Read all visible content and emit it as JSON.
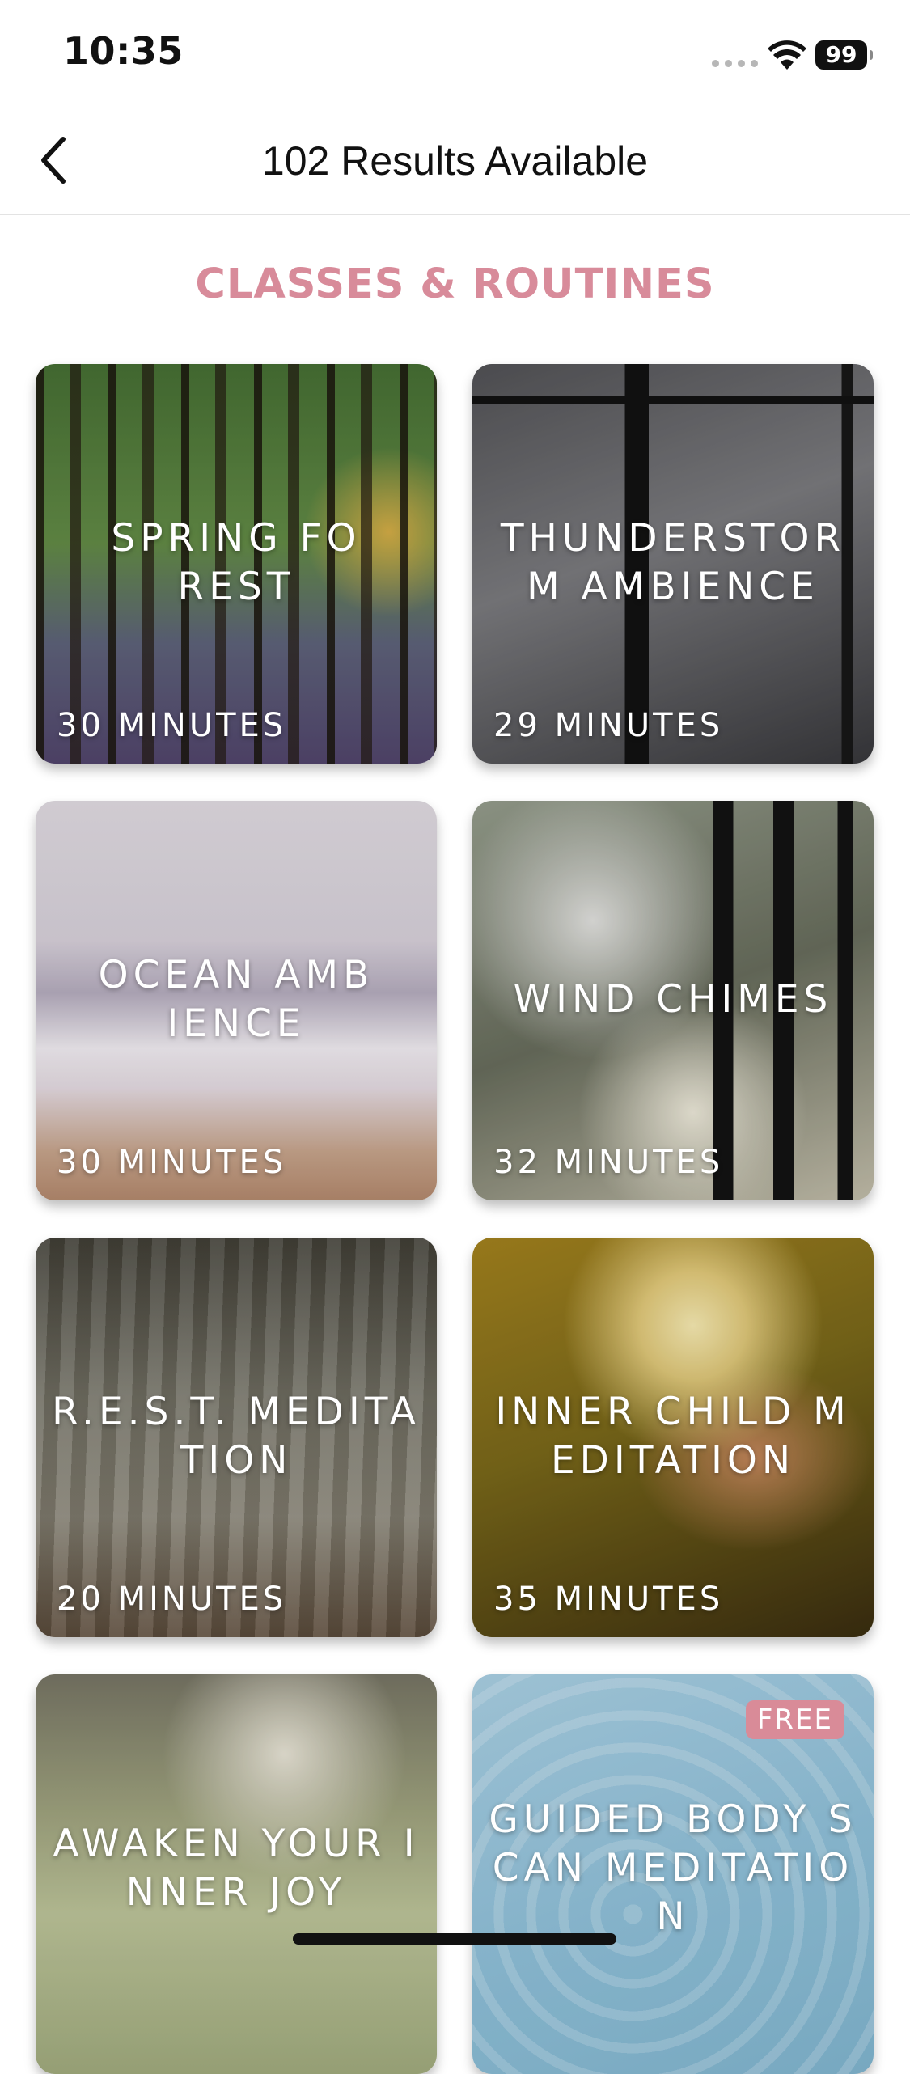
{
  "status_bar": {
    "time": "10:35",
    "battery": "99"
  },
  "header": {
    "title": "102 Results Available",
    "back_icon": "chevron-left-icon"
  },
  "section": {
    "title": "CLASSES & ROUTINES",
    "color": "#d88b9a"
  },
  "cards": [
    {
      "title": "SPRING FOREST",
      "duration": "30 MINUTES"
    },
    {
      "title": "THUNDERSTORM AMBIENCE",
      "duration": "29 MINUTES"
    },
    {
      "title": "OCEAN AMBIENCE",
      "duration": "30 MINUTES"
    },
    {
      "title": "WIND CHIMES",
      "duration": "32 MINUTES"
    },
    {
      "title": "R.E.S.T. MEDITATION",
      "duration": "20 MINUTES"
    },
    {
      "title": "INNER CHILD MEDITATION",
      "duration": "35 MINUTES"
    },
    {
      "title": "AWAKEN YOUR INNER JOY",
      "duration": ""
    },
    {
      "title": "GUIDED BODY SCAN MEDITATION",
      "duration": "",
      "badge": "FREE"
    }
  ]
}
